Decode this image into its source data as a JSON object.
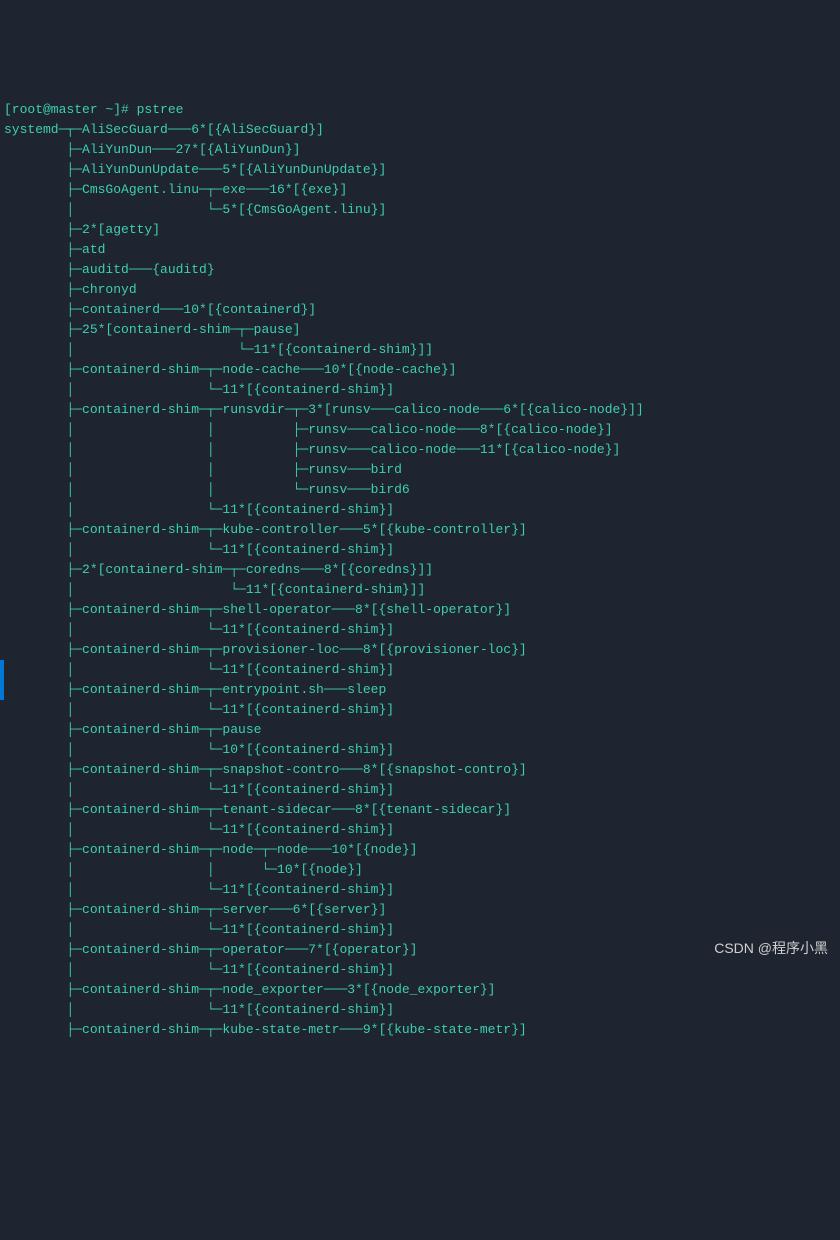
{
  "prompt": "[root@master ~]# pstree",
  "watermark": "CSDN @程序小黑",
  "tree_lines": [
    "systemd─┬─AliSecGuard───6*[{AliSecGuard}]",
    "        ├─AliYunDun───27*[{AliYunDun}]",
    "        ├─AliYunDunUpdate───5*[{AliYunDunUpdate}]",
    "        ├─CmsGoAgent.linu─┬─exe───16*[{exe}]",
    "        │                 └─5*[{CmsGoAgent.linu}]",
    "        ├─2*[agetty]",
    "        ├─atd",
    "        ├─auditd───{auditd}",
    "        ├─chronyd",
    "        ├─containerd───10*[{containerd}]",
    "        ├─25*[containerd-shim─┬─pause]",
    "        │                     └─11*[{containerd-shim}]]",
    "        ├─containerd-shim─┬─node-cache───10*[{node-cache}]",
    "        │                 └─11*[{containerd-shim}]",
    "        ├─containerd-shim─┬─runsvdir─┬─3*[runsv───calico-node───6*[{calico-node}]]",
    "        │                 │          ├─runsv───calico-node───8*[{calico-node}]",
    "        │                 │          ├─runsv───calico-node───11*[{calico-node}]",
    "        │                 │          ├─runsv───bird",
    "        │                 │          └─runsv───bird6",
    "        │                 └─11*[{containerd-shim}]",
    "        ├─containerd-shim─┬─kube-controller───5*[{kube-controller}]",
    "        │                 └─11*[{containerd-shim}]",
    "        ├─2*[containerd-shim─┬─coredns───8*[{coredns}]]",
    "        │                    └─11*[{containerd-shim}]]",
    "        ├─containerd-shim─┬─shell-operator───8*[{shell-operator}]",
    "        │                 └─11*[{containerd-shim}]",
    "        ├─containerd-shim─┬─provisioner-loc───8*[{provisioner-loc}]",
    "        │                 └─11*[{containerd-shim}]",
    "        ├─containerd-shim─┬─entrypoint.sh───sleep",
    "        │                 └─11*[{containerd-shim}]",
    "        ├─containerd-shim─┬─pause",
    "        │                 └─10*[{containerd-shim}]",
    "        ├─containerd-shim─┬─snapshot-contro───8*[{snapshot-contro}]",
    "        │                 └─11*[{containerd-shim}]",
    "        ├─containerd-shim─┬─tenant-sidecar───8*[{tenant-sidecar}]",
    "        │                 └─11*[{containerd-shim}]",
    "        ├─containerd-shim─┬─node─┬─node───10*[{node}]",
    "        │                 │      └─10*[{node}]",
    "        │                 └─11*[{containerd-shim}]",
    "        ├─containerd-shim─┬─server───6*[{server}]",
    "        │                 └─11*[{containerd-shim}]",
    "        ├─containerd-shim─┬─operator───7*[{operator}]",
    "        │                 └─11*[{containerd-shim}]",
    "        ├─containerd-shim─┬─node_exporter───3*[{node_exporter}]",
    "        │                 └─11*[{containerd-shim}]",
    "        ├─containerd-shim─┬─kube-state-metr───9*[{kube-state-metr}]"
  ]
}
